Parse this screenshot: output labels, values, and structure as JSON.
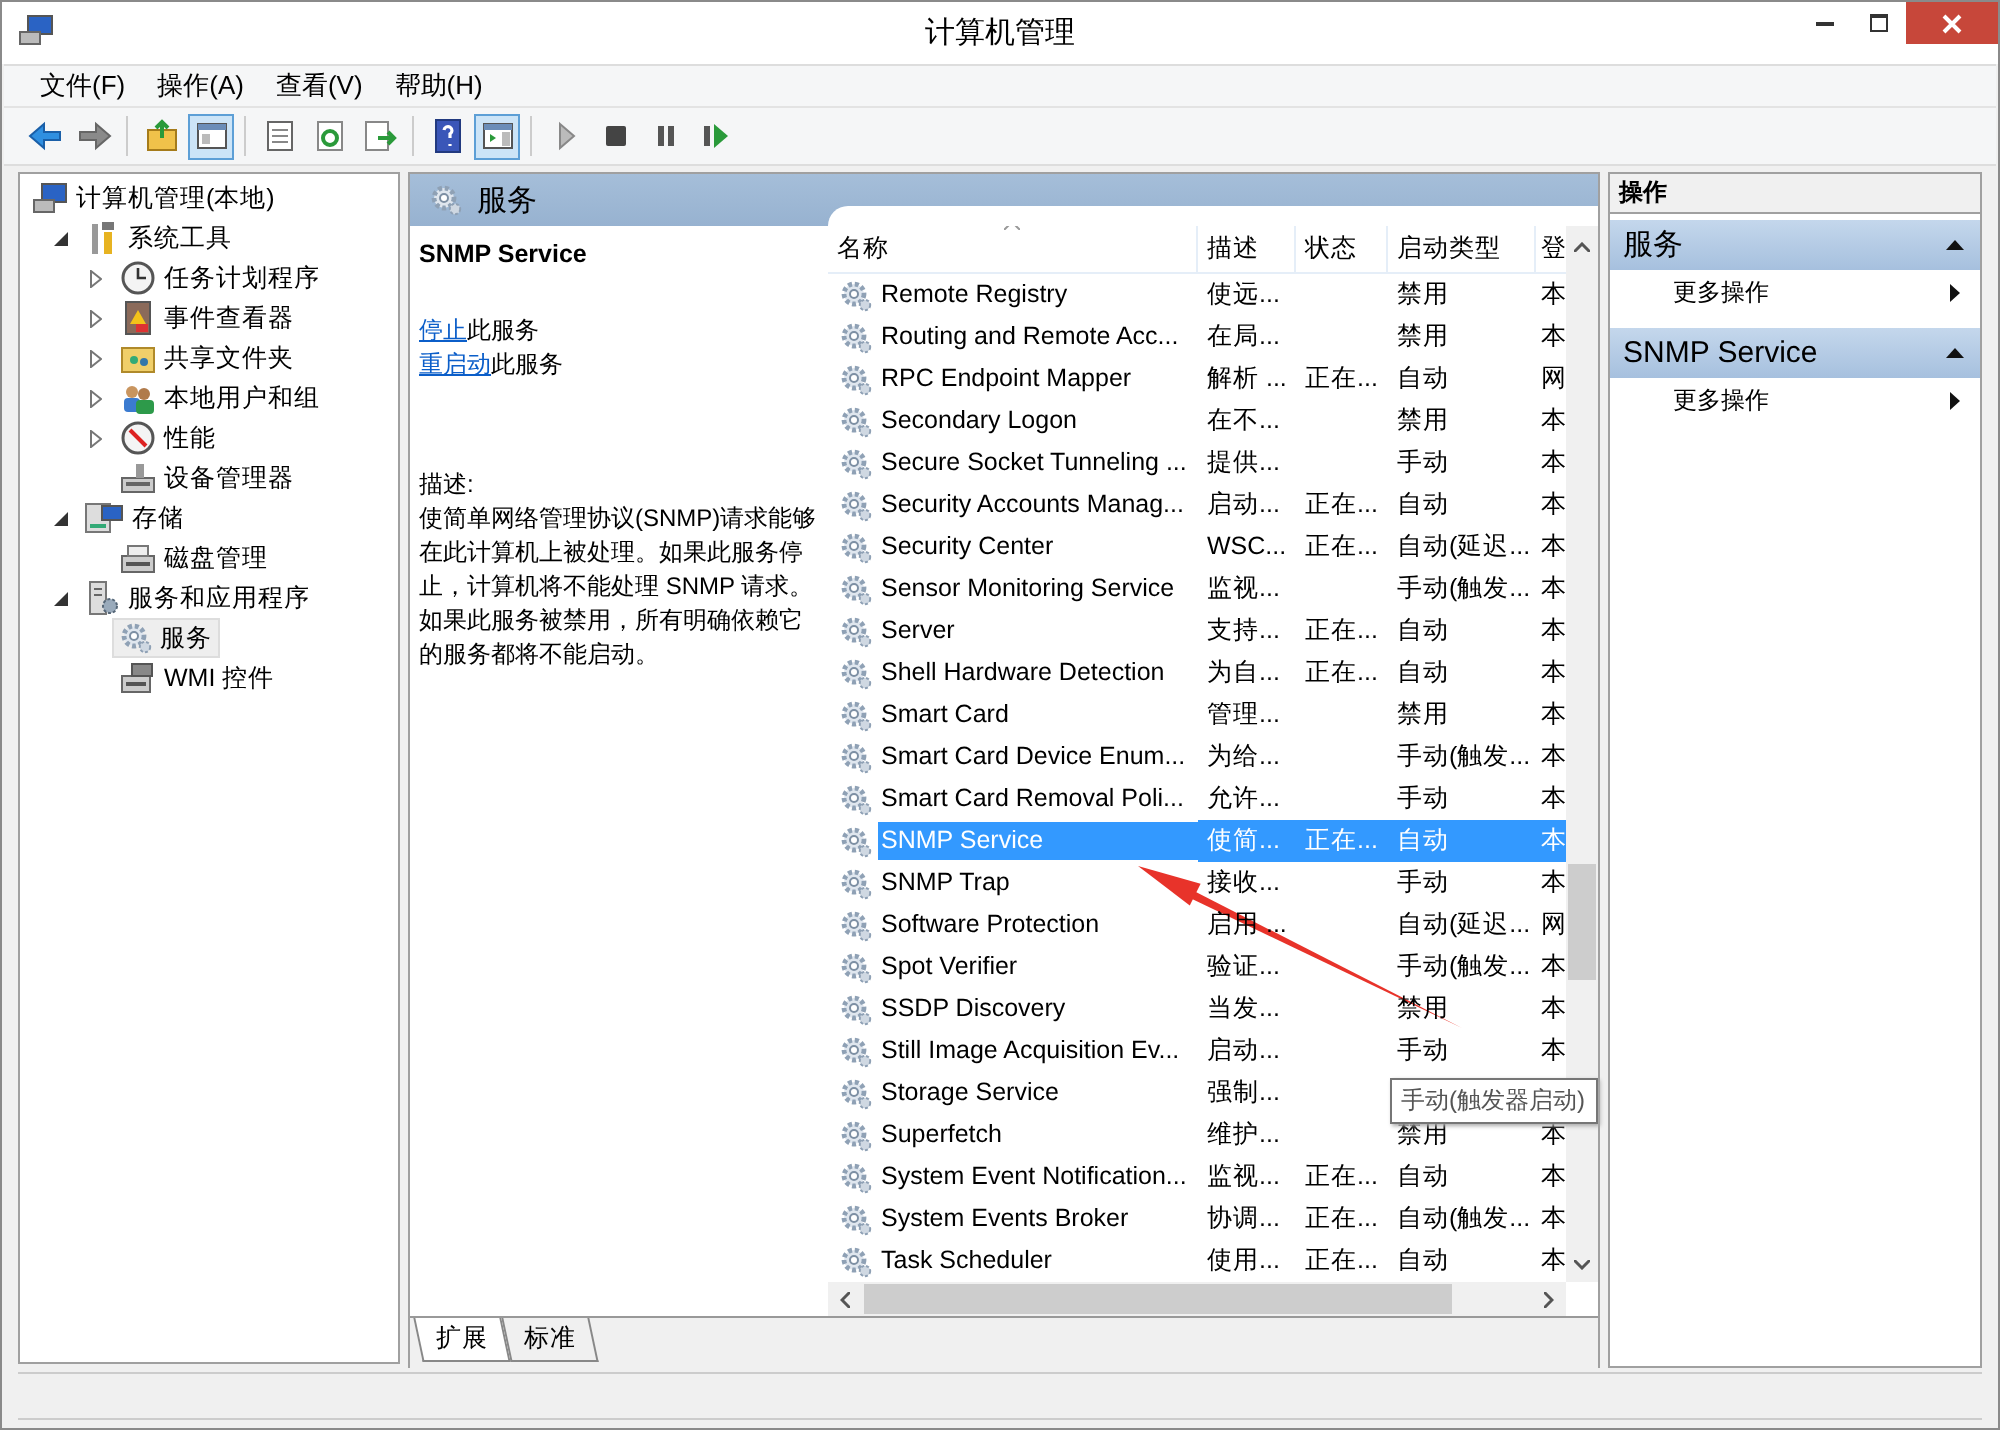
{
  "window": {
    "title": "计算机管理"
  },
  "menu": [
    {
      "label": "文件(F)"
    },
    {
      "label": "操作(A)"
    },
    {
      "label": "查看(V)"
    },
    {
      "label": "帮助(H)"
    }
  ],
  "toolbar": [
    {
      "kind": "back",
      "pressed": false
    },
    {
      "kind": "forward",
      "pressed": false
    },
    {
      "kind": "sep"
    },
    {
      "kind": "up",
      "pressed": false
    },
    {
      "kind": "tree",
      "pressed": true
    },
    {
      "kind": "sep"
    },
    {
      "kind": "props",
      "pressed": false
    },
    {
      "kind": "refresh",
      "pressed": false
    },
    {
      "kind": "export",
      "pressed": false
    },
    {
      "kind": "sep"
    },
    {
      "kind": "help",
      "pressed": false
    },
    {
      "kind": "pane",
      "pressed": true
    },
    {
      "kind": "sep"
    },
    {
      "kind": "play",
      "pressed": false
    },
    {
      "kind": "stop",
      "pressed": false
    },
    {
      "kind": "pause",
      "pressed": false
    },
    {
      "kind": "resume",
      "pressed": false
    }
  ],
  "tree": [
    {
      "label": "计算机管理(本地)",
      "kind": "computer",
      "selected": false,
      "children": [
        {
          "label": "系统工具",
          "kind": "tools",
          "expanded": true,
          "selected": false,
          "children": [
            {
              "label": "任务计划程序",
              "kind": "clock",
              "expanded": false,
              "selected": false
            },
            {
              "label": "事件查看器",
              "kind": "event",
              "expanded": false,
              "selected": false
            },
            {
              "label": "共享文件夹",
              "kind": "share",
              "expanded": false,
              "selected": false
            },
            {
              "label": "本地用户和组",
              "kind": "users",
              "expanded": false,
              "selected": false
            },
            {
              "label": "性能",
              "kind": "perf",
              "expanded": false,
              "selected": false
            },
            {
              "label": "设备管理器",
              "kind": "device",
              "selected": false
            }
          ]
        },
        {
          "label": "存储",
          "kind": "storage",
          "expanded": true,
          "selected": false,
          "children": [
            {
              "label": "磁盘管理",
              "kind": "disk",
              "selected": false
            }
          ]
        },
        {
          "label": "服务和应用程序",
          "kind": "apps",
          "expanded": true,
          "selected": false,
          "children": [
            {
              "label": "服务",
              "kind": "gear",
              "selected": true
            },
            {
              "label": "WMI 控件",
              "kind": "wmi",
              "selected": false
            }
          ]
        }
      ]
    }
  ],
  "panel": {
    "title": "服务"
  },
  "detail": {
    "name": "SNMP Service",
    "actions": [
      {
        "link": "停止",
        "text": "此服务"
      },
      {
        "link": "重启动",
        "text": "此服务"
      }
    ],
    "description_label": "描述:",
    "description": "使简单网络管理协议(SNMP)请求能够在此计算机上被处理。如果此服务停止，计算机将不能处理 SNMP 请求。如果此服务被禁用，所有明确依赖它的服务都将不能启动。"
  },
  "table": {
    "columns": [
      "名称",
      "描述",
      "状态",
      "启动类型",
      "登"
    ],
    "rows": [
      {
        "name": "Remote Registry",
        "description": "使远...",
        "startup": "禁用",
        "column_5": "本",
        "selected": false
      },
      {
        "name": "Routing and Remote Acc...",
        "description": "在局...",
        "startup": "禁用",
        "column_5": "本",
        "selected": false
      },
      {
        "name": "RPC Endpoint Mapper",
        "description": "解析 ...",
        "status": "正在...",
        "startup": "自动",
        "column_5": "网",
        "selected": false
      },
      {
        "name": "Secondary Logon",
        "description": "在不...",
        "startup": "禁用",
        "column_5": "本",
        "selected": false
      },
      {
        "name": "Secure Socket Tunneling ...",
        "description": "提供...",
        "startup": "手动",
        "column_5": "本",
        "selected": false
      },
      {
        "name": "Security Accounts Manag...",
        "description": "启动...",
        "status": "正在...",
        "startup": "自动",
        "column_5": "本",
        "selected": false
      },
      {
        "name": "Security Center",
        "description": "WSC...",
        "status": "正在...",
        "startup": "自动(延迟...",
        "column_5": "本",
        "selected": false
      },
      {
        "name": "Sensor Monitoring Service",
        "description": "监视...",
        "startup": "手动(触发...",
        "column_5": "本",
        "selected": false
      },
      {
        "name": "Server",
        "description": "支持...",
        "status": "正在...",
        "startup": "自动",
        "column_5": "本",
        "selected": false
      },
      {
        "name": "Shell Hardware Detection",
        "description": "为自...",
        "status": "正在...",
        "startup": "自动",
        "column_5": "本",
        "selected": false
      },
      {
        "name": "Smart Card",
        "description": "管理...",
        "startup": "禁用",
        "column_5": "本",
        "selected": false
      },
      {
        "name": "Smart Card Device Enum...",
        "description": "为给...",
        "startup": "手动(触发...",
        "column_5": "本",
        "selected": false
      },
      {
        "name": "Smart Card Removal Poli...",
        "description": "允许...",
        "startup": "手动",
        "column_5": "本",
        "selected": false
      },
      {
        "name": "SNMP Service",
        "description": "使简...",
        "status": "正在...",
        "startup": "自动",
        "column_5": "本",
        "selected": true
      },
      {
        "name": "SNMP Trap",
        "description": "接收...",
        "startup": "手动",
        "column_5": "本",
        "selected": false
      },
      {
        "name": "Software Protection",
        "description": "启用 ...",
        "startup": "自动(延迟...",
        "column_5": "网",
        "selected": false
      },
      {
        "name": "Spot Verifier",
        "description": "验证...",
        "startup": "手动(触发...",
        "column_5": "本",
        "selected": false
      },
      {
        "name": "SSDP Discovery",
        "description": "当发...",
        "startup": "禁用",
        "column_5": "本",
        "selected": false
      },
      {
        "name": "Still Image Acquisition Ev...",
        "description": "启动...",
        "startup": "手动",
        "column_5": "本",
        "selected": false
      },
      {
        "name": "Storage Service",
        "description": "强制...",
        "selected": false
      },
      {
        "name": "Superfetch",
        "description": "维护...",
        "startup": "禁用",
        "column_5": "本",
        "selected": false
      },
      {
        "name": "System Event Notification...",
        "description": "监视...",
        "status": "正在...",
        "startup": "自动",
        "column_5": "本",
        "selected": false
      },
      {
        "name": "System Events Broker",
        "description": "协调...",
        "status": "正在...",
        "startup": "自动(触发...",
        "column_5": "本",
        "selected": false
      },
      {
        "name": "Task Scheduler",
        "description": "使用...",
        "status": "正在...",
        "startup": "自动",
        "column_5": "本",
        "selected": false
      }
    ]
  },
  "tooltip": {
    "text": "手动(触发器启动)"
  },
  "view_tabs": [
    {
      "label": "扩展",
      "selected": true
    },
    {
      "label": "标准",
      "selected": false
    }
  ],
  "actions_pane": {
    "title": "操作",
    "sections": [
      {
        "title": "服务",
        "items": [
          "更多操作"
        ]
      },
      {
        "title": "SNMP Service",
        "items": [
          "更多操作"
        ]
      }
    ]
  }
}
